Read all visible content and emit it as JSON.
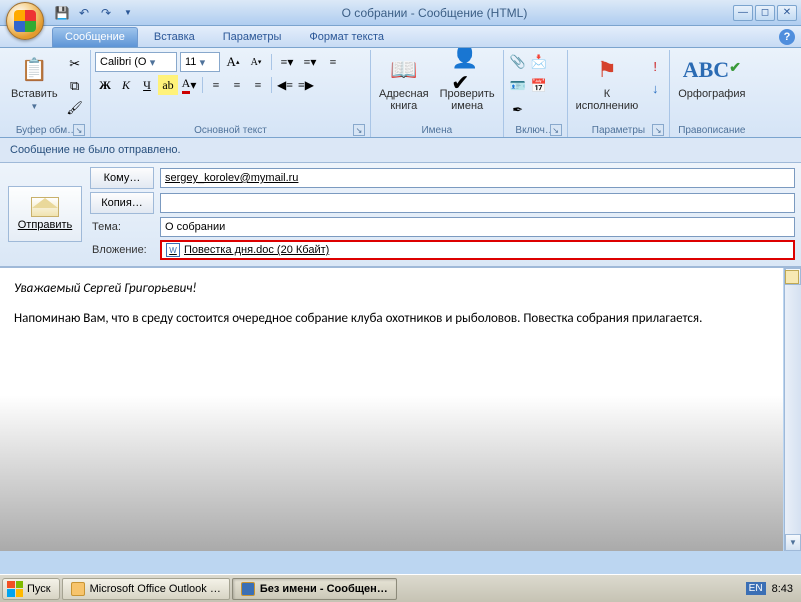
{
  "window": {
    "title": "О собрании - Сообщение (HTML)"
  },
  "tabs": {
    "t0": "Сообщение",
    "t1": "Вставка",
    "t2": "Параметры",
    "t3": "Формат текста"
  },
  "ribbon": {
    "clipboard": {
      "paste": "Вставить",
      "label": "Буфер обм…"
    },
    "font": {
      "name": "Calibri (О",
      "size": "11",
      "label": "Основной текст"
    },
    "names": {
      "addressbook": "Адресная\nкнига",
      "checknames": "Проверить\nимена",
      "label": "Имена"
    },
    "include": {
      "label": "Включ…"
    },
    "followup": {
      "btn": "К\nисполнению",
      "label": "Параметры"
    },
    "proof": {
      "btn": "Орфография",
      "label": "Правописание"
    }
  },
  "infobar": "Сообщение не было отправлено.",
  "header": {
    "send": "Отправить",
    "to_btn": "Кому…",
    "cc_btn": "Копия…",
    "to_val": "sergey_korolev@mymail.ru",
    "cc_val": "",
    "subject_lbl": "Тема:",
    "subject_val": "О собрании",
    "attach_lbl": "Вложение:",
    "attach_file": "Повестка дня.doc (20 Кбайт)"
  },
  "body": {
    "greeting": "Уважаемый Сергей Григорьевич!",
    "para": "Напоминаю  Вам, что в среду состоится очередное собрание клуба охотников и рыболовов. Повестка собрания прилагается."
  },
  "taskbar": {
    "start": "Пуск",
    "task1": "Microsoft Office Outlook …",
    "task2": "Без имени - Сообщен…",
    "lang": "EN",
    "clock": "8:43"
  }
}
